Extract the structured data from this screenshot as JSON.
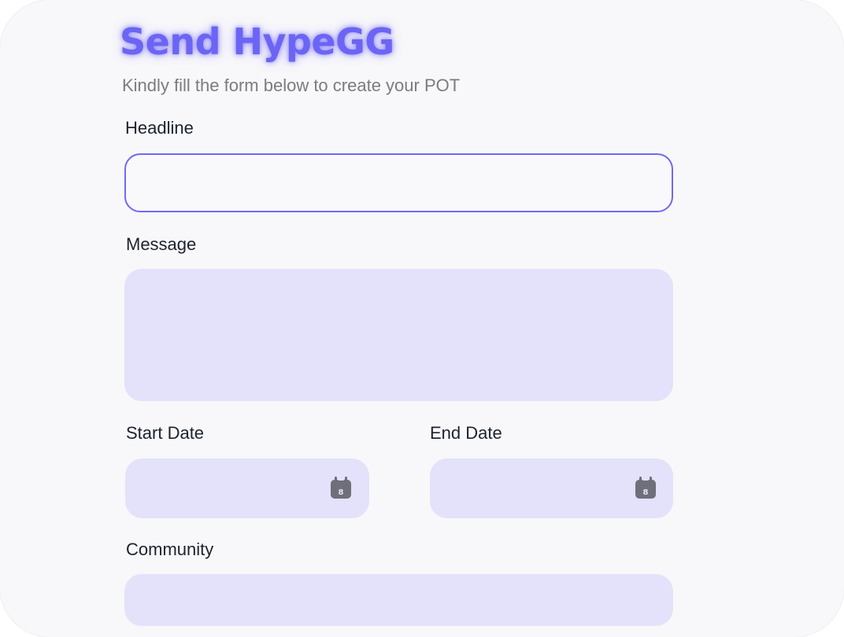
{
  "header": {
    "title": "Send HypeGG",
    "subtitle": "Kindly fill the form below to create your POT"
  },
  "form": {
    "headline": {
      "label": "Headline",
      "value": "",
      "placeholder": ""
    },
    "message": {
      "label": "Message",
      "value": "",
      "placeholder": ""
    },
    "start_date": {
      "label": "Start Date",
      "value": "",
      "icon": "calendar-icon",
      "icon_text": "8"
    },
    "end_date": {
      "label": "End Date",
      "value": "",
      "icon": "calendar-icon",
      "icon_text": "8"
    },
    "community": {
      "label": "Community",
      "value": "",
      "placeholder": ""
    }
  },
  "colors": {
    "accent": "#6c64f4",
    "field_background": "#e3e2fa",
    "focus_border": "#7168f5",
    "card_background": "#f8f8fa",
    "icon": "#6f6f7a"
  }
}
